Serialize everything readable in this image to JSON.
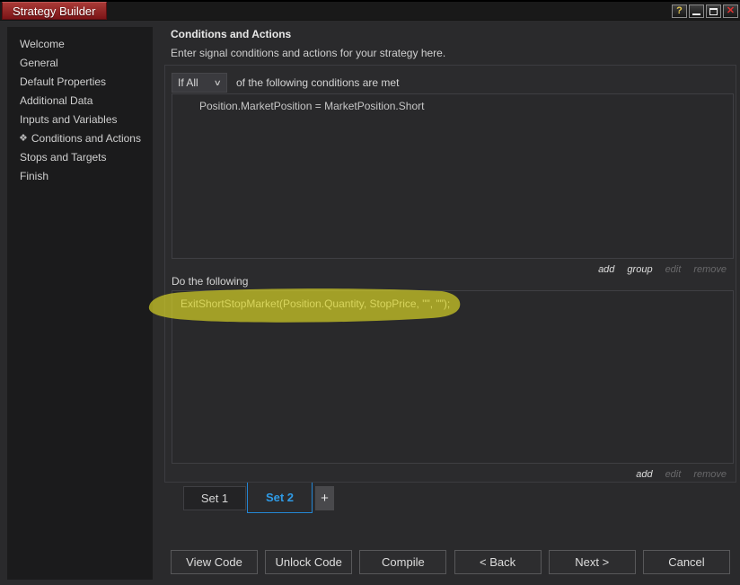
{
  "window": {
    "title": "Strategy Builder",
    "controls": {
      "help_glyph": "?",
      "close_glyph": "✕",
      "help_icon": "help-icon",
      "minimize_icon": "minimize-icon",
      "maximize_icon": "maximize-icon",
      "close_icon": "close-icon"
    }
  },
  "sidebar": {
    "items": [
      {
        "label": "Welcome",
        "active": false
      },
      {
        "label": "General",
        "active": false
      },
      {
        "label": "Default Properties",
        "active": false
      },
      {
        "label": "Additional Data",
        "active": false
      },
      {
        "label": "Inputs and Variables",
        "active": false
      },
      {
        "label": "Conditions and Actions",
        "active": true,
        "icon_glyph": "❖"
      },
      {
        "label": "Stops and Targets",
        "active": false
      },
      {
        "label": "Finish",
        "active": false
      }
    ]
  },
  "main": {
    "heading": "Conditions and Actions",
    "description": "Enter signal conditions and actions for your strategy here.",
    "conditions": {
      "mode_value": "If All",
      "mode_chevron": "∨",
      "mode_suffix": "of the following conditions are met",
      "items": [
        "Position.MarketPosition = MarketPosition.Short"
      ],
      "links": [
        {
          "label": "add",
          "enabled": true
        },
        {
          "label": "group",
          "enabled": true
        },
        {
          "label": "edit",
          "enabled": false
        },
        {
          "label": "remove",
          "enabled": false
        }
      ]
    },
    "actions": {
      "label": "Do the following",
      "items": [
        "ExitShortStopMarket(Position.Quantity, StopPrice, \"\", \"\");"
      ],
      "links": [
        {
          "label": "add",
          "enabled": true
        },
        {
          "label": "edit",
          "enabled": false
        },
        {
          "label": "remove",
          "enabled": false
        }
      ]
    },
    "tabs": [
      {
        "label": "Set 1",
        "selected": false
      },
      {
        "label": "Set 2",
        "selected": true
      }
    ],
    "add_tab_label": "+",
    "buttons": [
      {
        "label": "View Code"
      },
      {
        "label": "Unlock Code"
      },
      {
        "label": "Compile"
      },
      {
        "label": "< Back"
      },
      {
        "label": "Next >"
      },
      {
        "label": "Cancel"
      }
    ]
  },
  "annotation": {
    "type": "highlighter-stroke",
    "color": "#e0dc26",
    "opacity": 0.66
  },
  "colors": {
    "accent_red": "#8b1a1d",
    "accent_blue": "#2386d4",
    "selected_tab_text": "#2f9be6"
  }
}
